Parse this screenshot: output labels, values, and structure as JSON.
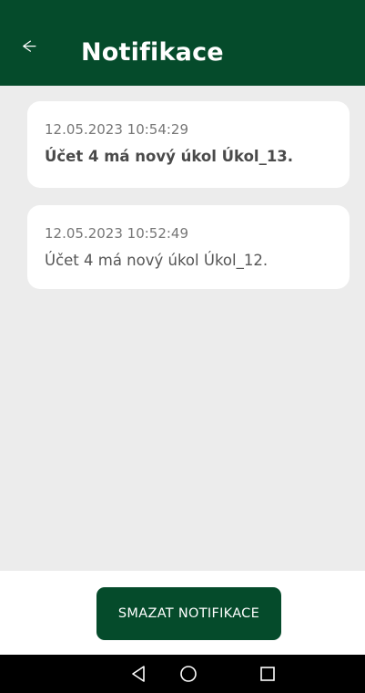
{
  "header": {
    "title": "Notifikace",
    "background_color": "#054b2b",
    "back_icon": "arrow-left-icon"
  },
  "notifications": [
    {
      "timestamp": "12.05.2023 10:54:29",
      "message": "Účet 4 má nový úkol Úkol_13.",
      "unread": true
    },
    {
      "timestamp": "12.05.2023 10:52:49",
      "message": "Účet 4 má nový úkol Úkol_12.",
      "unread": false
    }
  ],
  "actions": {
    "clear_label": "SMAZAT NOTIFIKACE"
  },
  "system_nav": {
    "icons": [
      "triangle-back-icon",
      "circle-home-icon",
      "square-recents-icon"
    ]
  }
}
